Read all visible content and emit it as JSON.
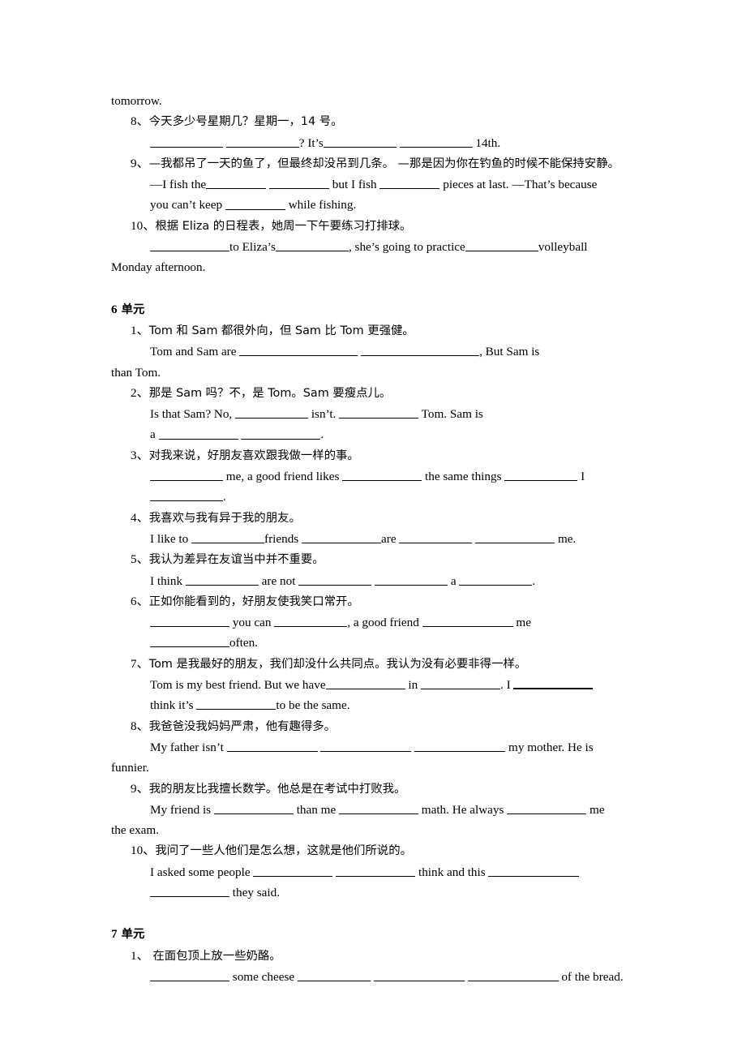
{
  "document": {
    "continuation_line": "tomorrow.",
    "sections": [
      {
        "id": "section-unit5-tail",
        "heading": null,
        "items": [
          {
            "number": "8、",
            "prompt_cn": "今天多少号星期几？星期一，14 号。",
            "answer_lines": [
              {
                "segments": [
                  {
                    "type": "blank",
                    "size": "b11"
                  },
                  {
                    "type": "text",
                    "value": " "
                  },
                  {
                    "type": "blank",
                    "size": "b11"
                  },
                  {
                    "type": "text",
                    "value": "?  It’s"
                  },
                  {
                    "type": "blank",
                    "size": "b11"
                  },
                  {
                    "type": "text",
                    "value": " "
                  },
                  {
                    "type": "blank",
                    "size": "b11"
                  },
                  {
                    "type": "text",
                    "value": " 14th."
                  }
                ]
              }
            ]
          },
          {
            "number": "9、",
            "prompt_cn": "—我都吊了一天的鱼了，但最终却没吊到几条。  —那是因为你在钓鱼的时候不能保持安静。",
            "answer_lines": [
              {
                "segments": [
                  {
                    "type": "text",
                    "value": "—I fish the"
                  },
                  {
                    "type": "blank",
                    "size": "b9"
                  },
                  {
                    "type": "text",
                    "value": " "
                  },
                  {
                    "type": "blank",
                    "size": "b9"
                  },
                  {
                    "type": "text",
                    "value": " but I fish "
                  },
                  {
                    "type": "blank",
                    "size": "b9"
                  },
                  {
                    "type": "text",
                    "value": " pieces at last.    —That’s because"
                  }
                ]
              },
              {
                "segments": [
                  {
                    "type": "text",
                    "value": "you can’t keep "
                  },
                  {
                    "type": "blank",
                    "size": "b9"
                  },
                  {
                    "type": "text",
                    "value": " while fishing."
                  }
                ]
              }
            ]
          },
          {
            "number": "10、",
            "prompt_cn": "根据 Eliza 的日程表，她周一下午要练习打排球。",
            "answer_lines": [
              {
                "segments": [
                  {
                    "type": "blank",
                    "size": "b12"
                  },
                  {
                    "type": "text",
                    "value": "to Eliza’s"
                  },
                  {
                    "type": "blank",
                    "size": "b11"
                  },
                  {
                    "type": "text",
                    "value": ", she’s going to practice"
                  },
                  {
                    "type": "blank",
                    "size": "b11"
                  },
                  {
                    "type": "text",
                    "value": "volleyball"
                  }
                ]
              },
              {
                "segments": [
                  {
                    "type": "text",
                    "value": "Monday afternoon."
                  }
                ]
              }
            ]
          }
        ]
      },
      {
        "id": "section-unit6",
        "heading": {
          "unit_number": "6",
          "unit_word": "单元"
        },
        "items": [
          {
            "number": "1、",
            "prompt_cn": "Tom 和 Sam 都很外向，但 Sam 比 Tom 更强健。",
            "answer_lines": [
              {
                "segments": [
                  {
                    "type": "text",
                    "value": "Tom  and  Sam  are  "
                  },
                  {
                    "type": "blank",
                    "size": "b18"
                  },
                  {
                    "type": "text",
                    "value": "  "
                  },
                  {
                    "type": "blank",
                    "size": "b18"
                  },
                  {
                    "type": "text",
                    "value": ",  But  Sam  is"
                  }
                ]
              },
              {
                "segments": [
                  {
                    "type": "text",
                    "value": "than Tom."
                  }
                ]
              }
            ]
          },
          {
            "number": "2、",
            "prompt_cn": "那是 Sam 吗？不，是 Tom。Sam 要瘦点儿。",
            "answer_lines": [
              {
                "segments": [
                  {
                    "type": "text",
                    "value": "Is    that    Sam?        No,   "
                  },
                  {
                    "type": "blank",
                    "size": "b11"
                  },
                  {
                    "type": "text",
                    "value": "   isn’t.   "
                  },
                  {
                    "type": "blank",
                    "size": "b12"
                  },
                  {
                    "type": "text",
                    "value": "   Tom.   Sam   is"
                  }
                ]
              },
              {
                "segments": [
                  {
                    "type": "text",
                    "value": "a "
                  },
                  {
                    "type": "blank",
                    "size": "b12"
                  },
                  {
                    "type": "text",
                    "value": " "
                  },
                  {
                    "type": "blank",
                    "size": "b12"
                  },
                  {
                    "type": "text",
                    "value": "."
                  }
                ]
              }
            ]
          },
          {
            "number": "3、",
            "prompt_cn": "对我来说，好朋友喜欢跟我做一样的事。",
            "answer_lines": [
              {
                "segments": [
                  {
                    "type": "blank",
                    "size": "b11"
                  },
                  {
                    "type": "text",
                    "value": "  me, a  good  friend  likes  "
                  },
                  {
                    "type": "blank",
                    "size": "b12"
                  },
                  {
                    "type": "text",
                    "value": "  the  same  things  "
                  },
                  {
                    "type": "blank",
                    "size": "b11"
                  },
                  {
                    "type": "text",
                    "value": "  I"
                  }
                ]
              },
              {
                "segments": [
                  {
                    "type": "blank",
                    "size": "b11"
                  },
                  {
                    "type": "text",
                    "value": "."
                  }
                ]
              }
            ]
          },
          {
            "number": "4、",
            "prompt_cn": "我喜欢与我有异于我的朋友。",
            "answer_lines": [
              {
                "segments": [
                  {
                    "type": "text",
                    "value": "I like to "
                  },
                  {
                    "type": "blank",
                    "size": "b11"
                  },
                  {
                    "type": "text",
                    "value": "friends "
                  },
                  {
                    "type": "blank",
                    "size": "b12"
                  },
                  {
                    "type": "text",
                    "value": "are "
                  },
                  {
                    "type": "blank",
                    "size": "b11"
                  },
                  {
                    "type": "text",
                    "value": " "
                  },
                  {
                    "type": "blank",
                    "size": "b12"
                  },
                  {
                    "type": "text",
                    "value": " me."
                  }
                ]
              }
            ]
          },
          {
            "number": "5、",
            "prompt_cn": "我认为差异在友谊当中并不重要。",
            "answer_lines": [
              {
                "segments": [
                  {
                    "type": "text",
                    "value": "I think "
                  },
                  {
                    "type": "blank",
                    "size": "b11"
                  },
                  {
                    "type": "text",
                    "value": " are not "
                  },
                  {
                    "type": "blank",
                    "size": "b11"
                  },
                  {
                    "type": "text",
                    "value": " "
                  },
                  {
                    "type": "blank",
                    "size": "b11"
                  },
                  {
                    "type": "text",
                    "value": " a "
                  },
                  {
                    "type": "blank",
                    "size": "b11"
                  },
                  {
                    "type": "text",
                    "value": "."
                  }
                ]
              }
            ]
          },
          {
            "number": "6、",
            "prompt_cn": "正如你能看到的，好朋友使我笑口常开。",
            "answer_lines": [
              {
                "segments": [
                  {
                    "type": "blank",
                    "size": "b12"
                  },
                  {
                    "type": "text",
                    "value": "    you    can    "
                  },
                  {
                    "type": "blank",
                    "size": "b11"
                  },
                  {
                    "type": "text",
                    "value": ",    a    good    friend    "
                  },
                  {
                    "type": "blank",
                    "size": "b14"
                  },
                  {
                    "type": "text",
                    "value": "    me"
                  }
                ]
              },
              {
                "segments": [
                  {
                    "type": "blank",
                    "size": "b12"
                  },
                  {
                    "type": "text",
                    "value": "often."
                  }
                ]
              }
            ]
          },
          {
            "number": "7、",
            "prompt_cn": "Tom 是我最好的朋友，我们却没什么共同点。我认为没有必要非得一样。",
            "answer_lines": [
              {
                "segments": [
                  {
                    "type": "text",
                    "value": "Tom is my best friend. But we have"
                  },
                  {
                    "type": "blank",
                    "size": "b12"
                  },
                  {
                    "type": "text",
                    "value": "  in  "
                  },
                  {
                    "type": "blank",
                    "size": "b12"
                  },
                  {
                    "type": "text",
                    "value": ". I  "
                  },
                  {
                    "type": "blank",
                    "size": "b12",
                    "style": "bold-end"
                  }
                ]
              },
              {
                "segments": [
                  {
                    "type": "text",
                    "value": "think it’s  "
                  },
                  {
                    "type": "blank",
                    "size": "b12"
                  },
                  {
                    "type": "text",
                    "value": "to be the same."
                  }
                ]
              }
            ]
          },
          {
            "number": "8、",
            "prompt_cn": "我爸爸没我妈妈严肃，他有趣得多。",
            "answer_lines": [
              {
                "segments": [
                  {
                    "type": "text",
                    "value": "My father isn’t  "
                  },
                  {
                    "type": "blank",
                    "size": "b14"
                  },
                  {
                    "type": "text",
                    "value": "  "
                  },
                  {
                    "type": "blank",
                    "size": "b14"
                  },
                  {
                    "type": "text",
                    "value": "  "
                  },
                  {
                    "type": "blank",
                    "size": "b14"
                  },
                  {
                    "type": "text",
                    "value": "  my mother. He is"
                  }
                ]
              },
              {
                "segments": [
                  {
                    "type": "text",
                    "value": "funnier."
                  }
                ]
              }
            ]
          },
          {
            "number": "9、",
            "prompt_cn": "我的朋友比我擅长数学。他总是在考试中打败我。",
            "answer_lines": [
              {
                "segments": [
                  {
                    "type": "text",
                    "value": "My friend is  "
                  },
                  {
                    "type": "blank",
                    "size": "b12"
                  },
                  {
                    "type": "text",
                    "value": "  than me  "
                  },
                  {
                    "type": "blank",
                    "size": "b12"
                  },
                  {
                    "type": "text",
                    "value": "  math. He always  "
                  },
                  {
                    "type": "blank",
                    "size": "b12"
                  },
                  {
                    "type": "text",
                    "value": "  me"
                  }
                ]
              },
              {
                "segments": [
                  {
                    "type": "text",
                    "value": "the exam."
                  }
                ]
              }
            ]
          },
          {
            "number": "10、",
            "prompt_cn": "我问了一些人他们是怎么想，这就是他们所说的。",
            "answer_lines": [
              {
                "segments": [
                  {
                    "type": "text",
                    "value": "I  asked  some  people  "
                  },
                  {
                    "type": "blank",
                    "size": "b12"
                  },
                  {
                    "type": "text",
                    "value": "  "
                  },
                  {
                    "type": "blank",
                    "size": "b12"
                  },
                  {
                    "type": "text",
                    "value": "  think  and  this  "
                  },
                  {
                    "type": "blank",
                    "size": "b14"
                  }
                ]
              },
              {
                "segments": [
                  {
                    "type": "blank",
                    "size": "b12"
                  },
                  {
                    "type": "text",
                    "value": " they said."
                  }
                ]
              }
            ]
          }
        ]
      },
      {
        "id": "section-unit7",
        "heading": {
          "unit_number": "7",
          "unit_word": "单元"
        },
        "items": [
          {
            "number": "1、",
            "prompt_cn": " 在面包顶上放一些奶酪。",
            "answer_lines": [
              {
                "segments": [
                  {
                    "type": "blank",
                    "size": "b12"
                  },
                  {
                    "type": "text",
                    "value": " some cheese "
                  },
                  {
                    "type": "blank",
                    "size": "b11"
                  },
                  {
                    "type": "text",
                    "value": " "
                  },
                  {
                    "type": "blank",
                    "size": "b14"
                  },
                  {
                    "type": "text",
                    "value": " "
                  },
                  {
                    "type": "blank",
                    "size": "b14"
                  },
                  {
                    "type": "text",
                    "value": " of the bread."
                  }
                ]
              }
            ]
          }
        ]
      }
    ]
  }
}
